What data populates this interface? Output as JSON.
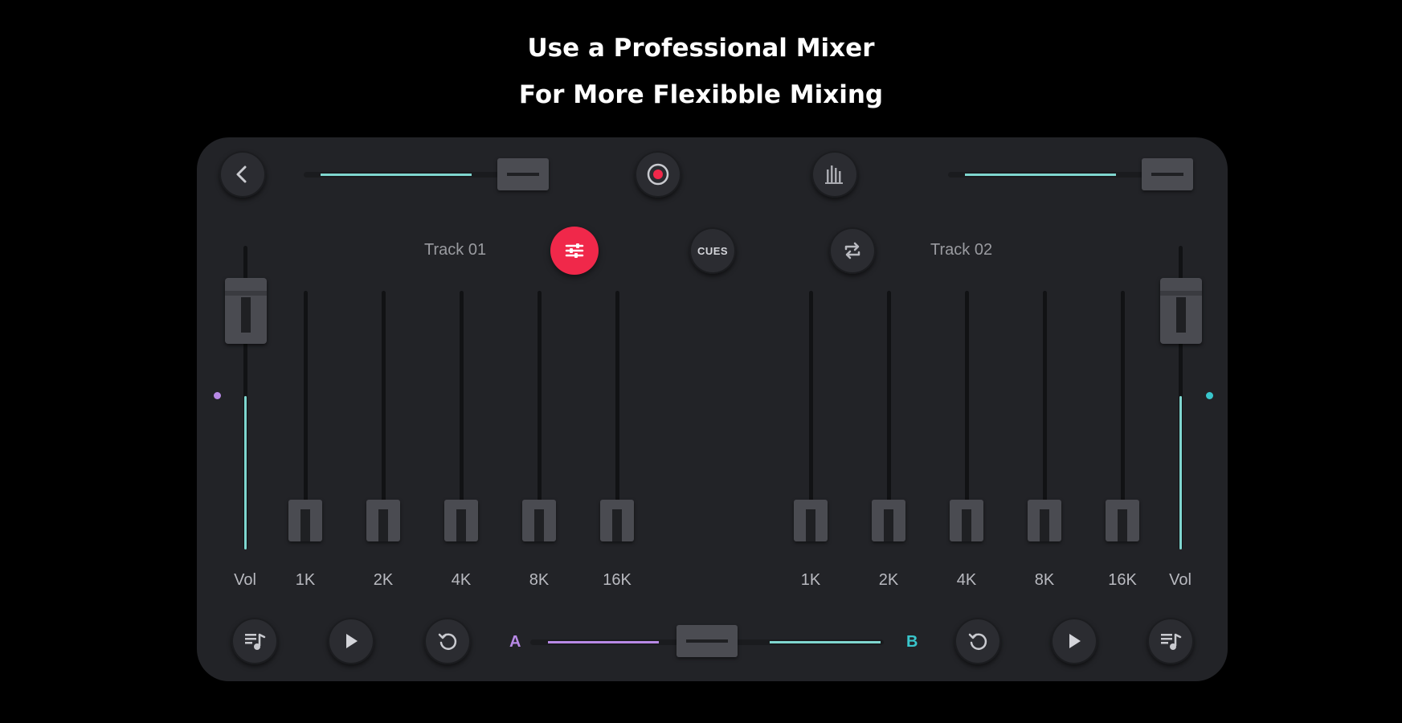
{
  "headline": {
    "line1": "Use a Professional Mixer",
    "line2": "For More Flexibble Mixing"
  },
  "toolbar": {
    "back_icon": "chevron-left-icon",
    "record_icon": "record-icon",
    "levels_icon": "levels-icon"
  },
  "deck_a": {
    "track_label": "Track 01",
    "volume_label": "Vol",
    "volume_level": 0.78,
    "pitch_level": 1.0,
    "eq": [
      {
        "label": "1K",
        "level": 0.0
      },
      {
        "label": "2K",
        "level": 0.0
      },
      {
        "label": "4K",
        "level": 0.0
      },
      {
        "label": "8K",
        "level": 0.0
      },
      {
        "label": "16K",
        "level": 0.0
      }
    ],
    "accent_color": "#c58ef0"
  },
  "deck_b": {
    "track_label": "Track 02",
    "volume_label": "Vol",
    "volume_level": 0.78,
    "pitch_level": 1.0,
    "eq": [
      {
        "label": "1K",
        "level": 0.0
      },
      {
        "label": "2K",
        "level": 0.0
      },
      {
        "label": "4K",
        "level": 0.0
      },
      {
        "label": "8K",
        "level": 0.0
      },
      {
        "label": "16K",
        "level": 0.0
      }
    ],
    "accent_color": "#39c6cc"
  },
  "center": {
    "cues_label": "CUES",
    "eq_icon": "sliders-icon",
    "sync_icon": "repeat-icon"
  },
  "crossfader": {
    "label_a": "A",
    "label_b": "B",
    "position": 0.5
  },
  "colors": {
    "eq_active": "#f0284a",
    "teal": "#7fd6cf",
    "purple": "#b889e6"
  }
}
